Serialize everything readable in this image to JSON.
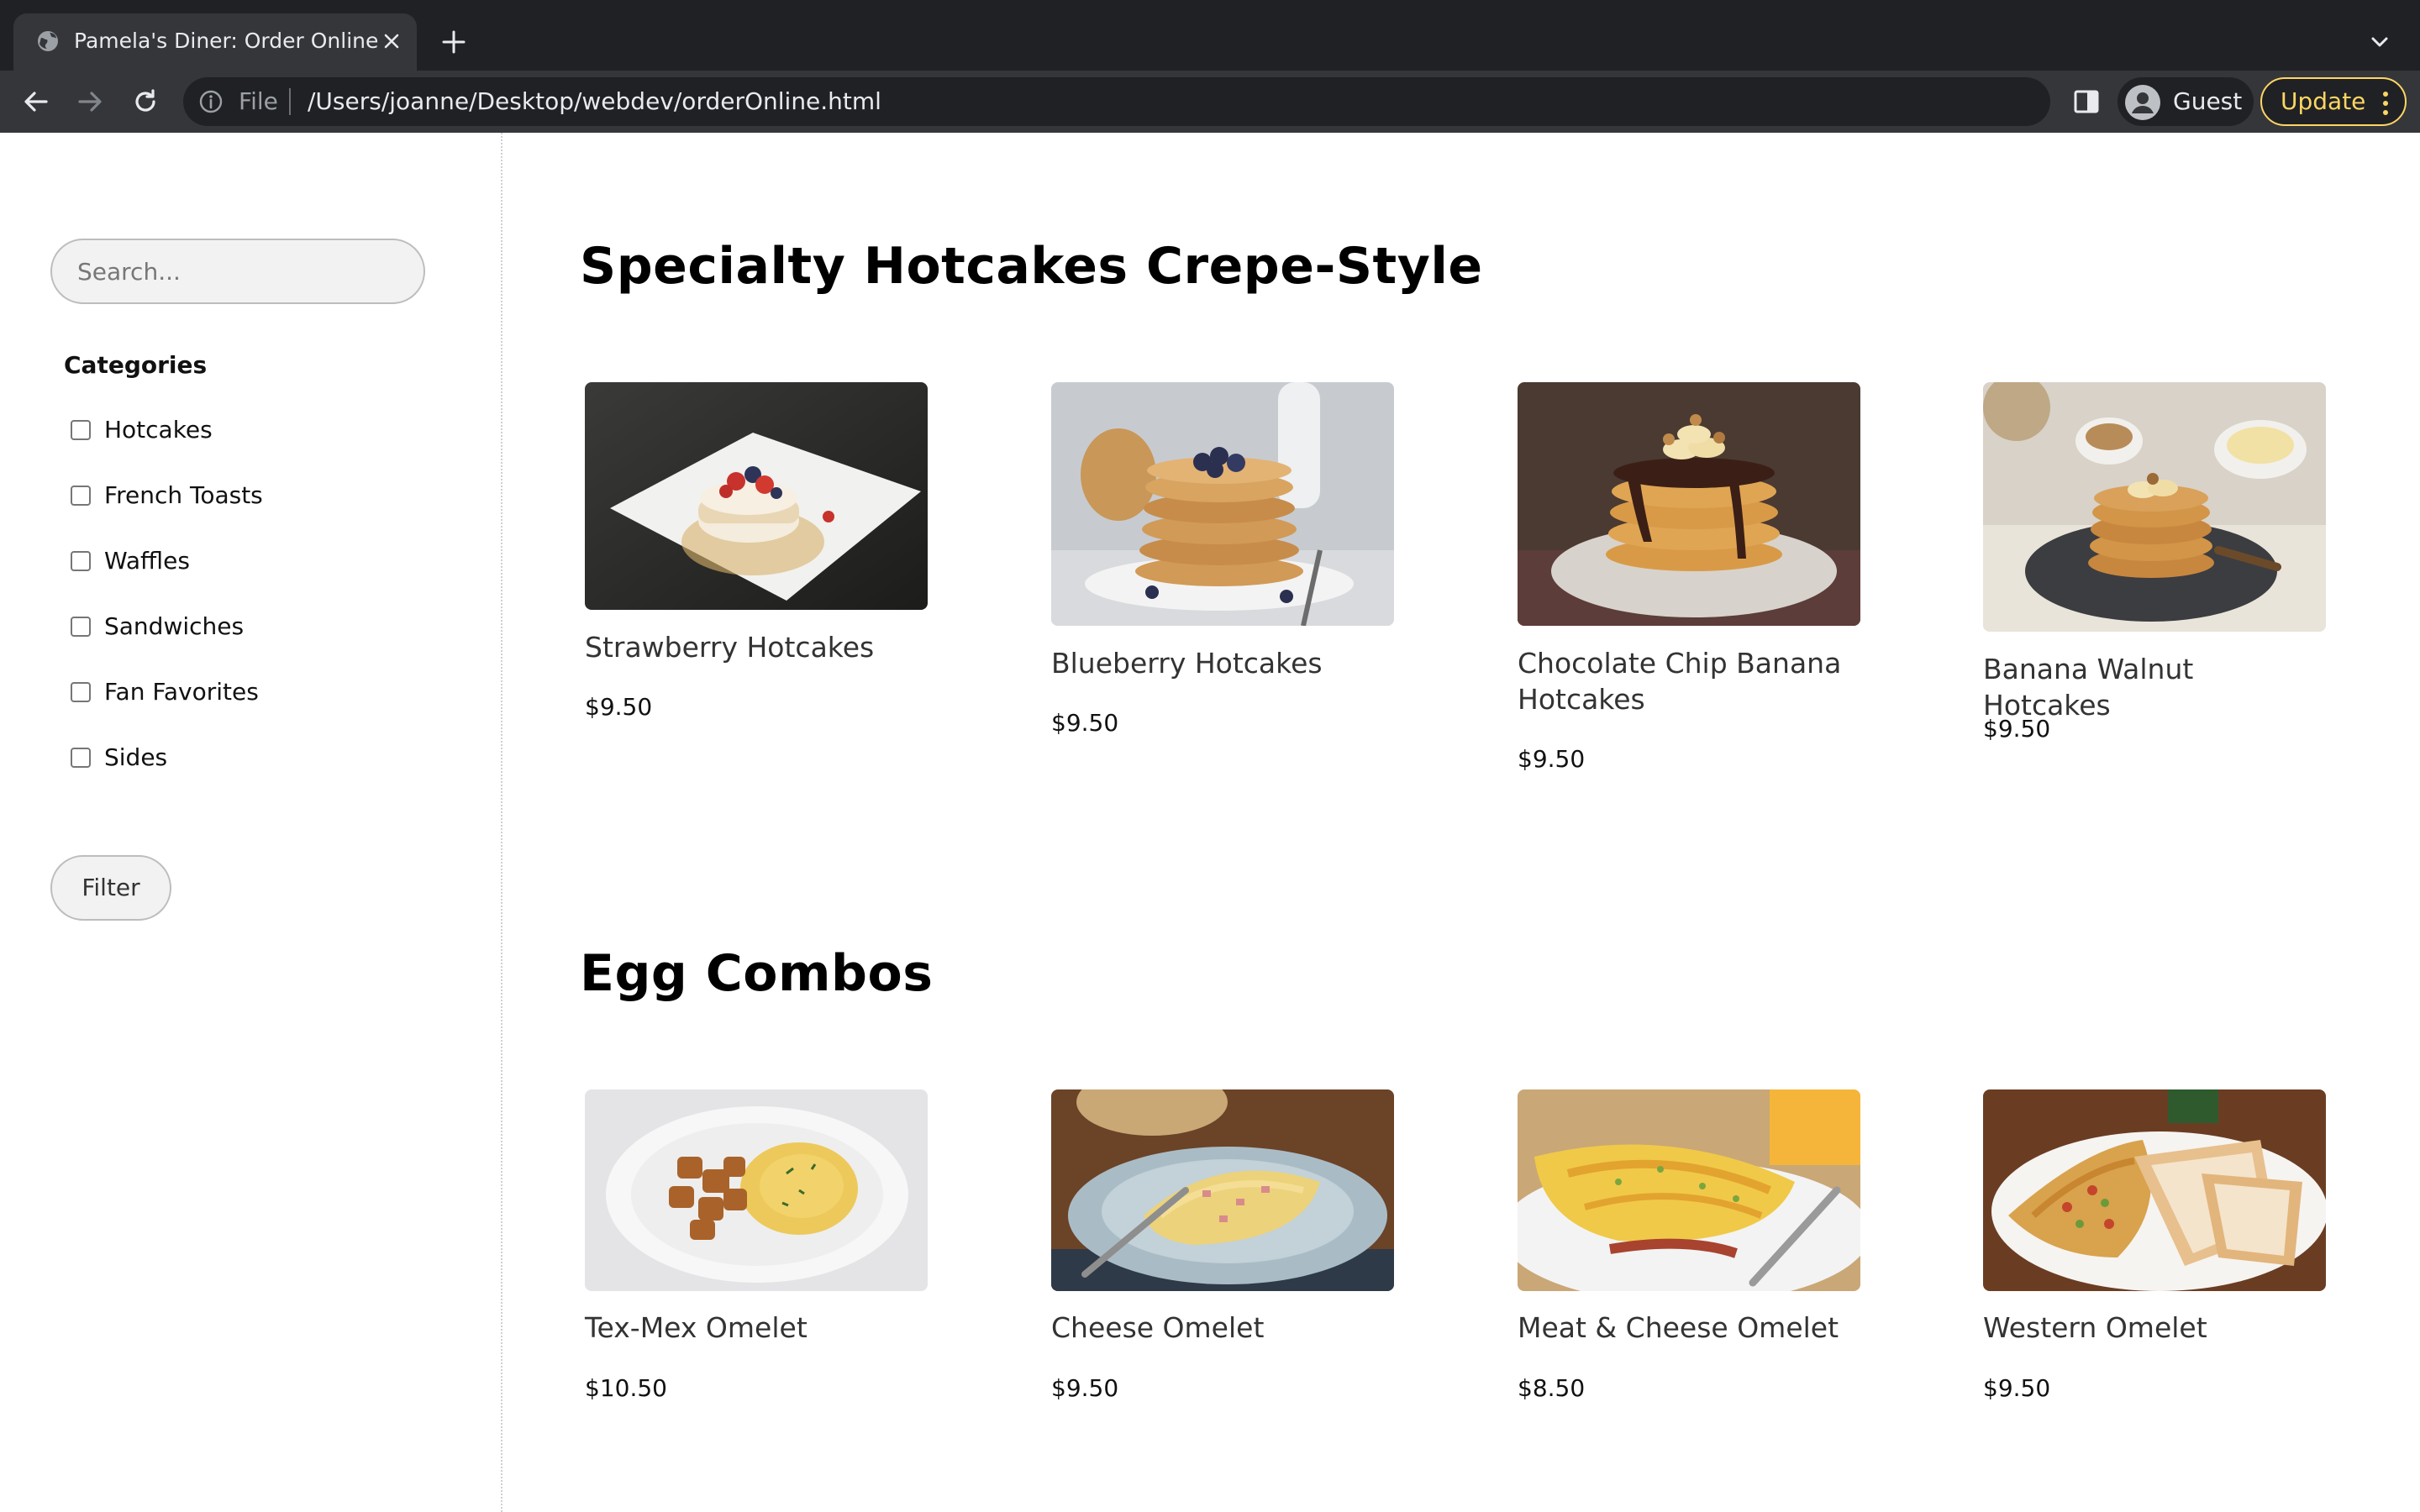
{
  "browser": {
    "tab_title": "Pamela's Diner: Order Online",
    "scheme_label": "File",
    "url": "/Users/joanne/Desktop/webdev/orderOnline.html",
    "profile_name": "Guest",
    "update_label": "Update"
  },
  "sidebar": {
    "search_placeholder": "Search...",
    "categories_title": "Categories",
    "categories": [
      "Hotcakes",
      "French Toasts",
      "Waffles",
      "Sandwiches",
      "Fan Favorites",
      "Sides"
    ],
    "filter_label": "Filter"
  },
  "sections": [
    {
      "title": "Specialty Hotcakes Crepe-Style",
      "items": [
        {
          "name": "Strawberry Hotcakes",
          "price": "$9.50",
          "image": "strawberry-hotcakes-photo"
        },
        {
          "name": "Blueberry Hotcakes",
          "price": "$9.50",
          "image": "blueberry-hotcakes-photo"
        },
        {
          "name": "Chocolate Chip Banana Hotcakes",
          "price": "$9.50",
          "image": "chocolate-banana-hotcakes-photo"
        },
        {
          "name": "Banana Walnut Hotcakes",
          "price": "$9.50",
          "image": "banana-walnut-hotcakes-photo"
        }
      ]
    },
    {
      "title": "Egg Combos",
      "items": [
        {
          "name": "Tex-Mex Omelet",
          "price": "$10.50",
          "image": "tex-mex-omelet-photo"
        },
        {
          "name": "Cheese Omelet",
          "price": "$9.50",
          "image": "cheese-omelet-photo"
        },
        {
          "name": "Meat & Cheese Omelet",
          "price": "$8.50",
          "image": "meat-cheese-omelet-photo"
        },
        {
          "name": "Western Omelet",
          "price": "$9.50",
          "image": "western-omelet-photo"
        }
      ]
    }
  ],
  "colors": {
    "chrome_dark": "#202124",
    "chrome_toolbar": "#35363a",
    "update_accent": "#fdd663",
    "page_background": "#ffffff"
  }
}
